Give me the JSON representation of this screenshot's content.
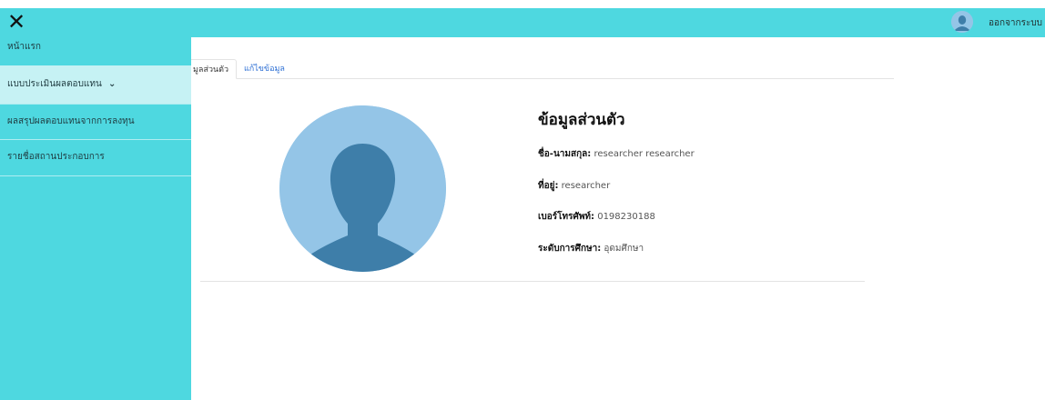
{
  "topbar": {
    "close_icon": "close-icon",
    "close_glyph": "✕",
    "user_icon": "user-avatar-icon",
    "logout_label": "ออกจากระบบ"
  },
  "sidebar": {
    "items": [
      {
        "label": "หน้าแรก"
      },
      {
        "label": "แบบประเมินผลตอบแทน",
        "caret": "⌄"
      },
      {
        "label": "ผลสรุปผลตอบแทนจากการลงทุน"
      },
      {
        "label": "รายชื่อสถานประกอบการ"
      }
    ]
  },
  "tabs": [
    {
      "label": "มูลส่วนตัว"
    },
    {
      "label": "แก้ไขข้อมูล"
    }
  ],
  "profile": {
    "title": "ข้อมูลส่วนตัว",
    "fields": [
      {
        "label": "ชื่อ-นามสกุล:",
        "value": "researcher researcher"
      },
      {
        "label": "ที่อยู่:",
        "value": "researcher"
      },
      {
        "label": "เบอร์โทรศัพท์:",
        "value": "0198230188"
      },
      {
        "label": "ระดับการศึกษา:",
        "value": "อุดมศึกษา"
      }
    ]
  },
  "colors": {
    "accent": "#4ed8e0",
    "sidebar_active": "#c6f2f4",
    "link": "#2c6fd4",
    "avatar_bg": "#94c5e7",
    "avatar_fg": "#3e7ea9"
  }
}
